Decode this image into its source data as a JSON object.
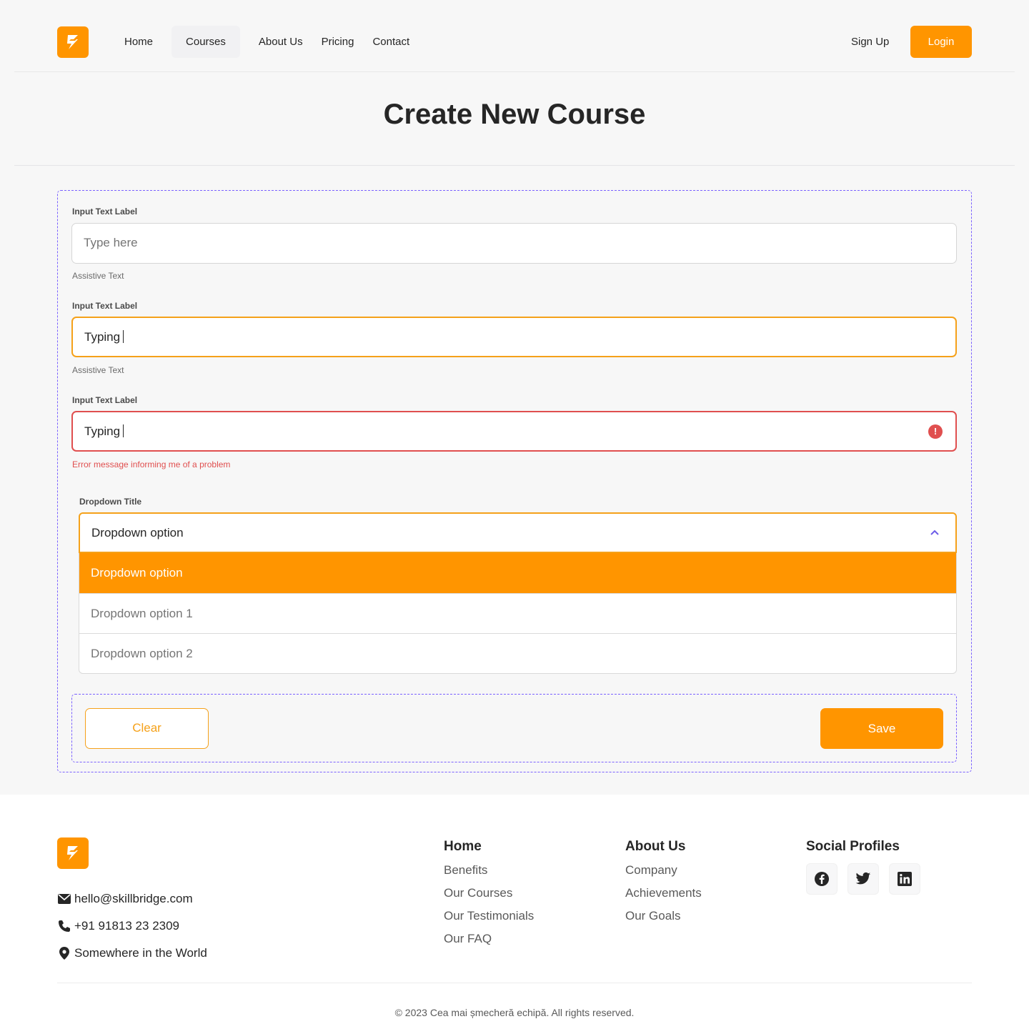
{
  "colors": {
    "accent": "#ff9500",
    "error": "#e04f4f",
    "dashed_outline": "#7b61ff"
  },
  "header": {
    "logo_icon": "skillbridge-logo-icon",
    "nav": [
      "Home",
      "Courses",
      "About Us",
      "Pricing",
      "Contact"
    ],
    "active_nav": "Courses",
    "signup_label": "Sign Up",
    "login_label": "Login"
  },
  "page": {
    "title": "Create New Course"
  },
  "form": {
    "field1": {
      "label": "Input Text Label",
      "placeholder": "Type here",
      "value": "",
      "assistive": "Assistive Text"
    },
    "field2": {
      "label": "Input Text Label",
      "value": "Typing",
      "assistive": "Assistive Text",
      "state": "focused"
    },
    "field3": {
      "label": "Input Text Label",
      "value": "Typing",
      "error": "Error message informing me of a problem",
      "state": "error",
      "icon": "error-icon"
    },
    "dropdown": {
      "title": "Dropdown Title",
      "selected": "Dropdown option",
      "icon": "chevron-up-icon",
      "options": [
        "Dropdown option",
        "Dropdown option 1",
        "Dropdown option 2"
      ]
    },
    "clear_label": "Clear",
    "save_label": "Save"
  },
  "footer": {
    "logo_icon": "skillbridge-logo-icon",
    "email": "hello@skillbridge.com",
    "phone": "+91 91813 23 2309",
    "location": "Somewhere in the World",
    "col_home": {
      "title": "Home",
      "links": [
        "Benefits",
        "Our Courses",
        "Our Testimonials",
        "Our FAQ"
      ]
    },
    "col_about": {
      "title": "About Us",
      "links": [
        "Company",
        "Achievements",
        "Our Goals"
      ]
    },
    "col_social": {
      "title": "Social Profiles",
      "icons": [
        "facebook-icon",
        "twitter-icon",
        "linkedin-icon"
      ]
    },
    "copyright": "© 2023 Cea mai șmecheră echipă. All rights reserved."
  }
}
